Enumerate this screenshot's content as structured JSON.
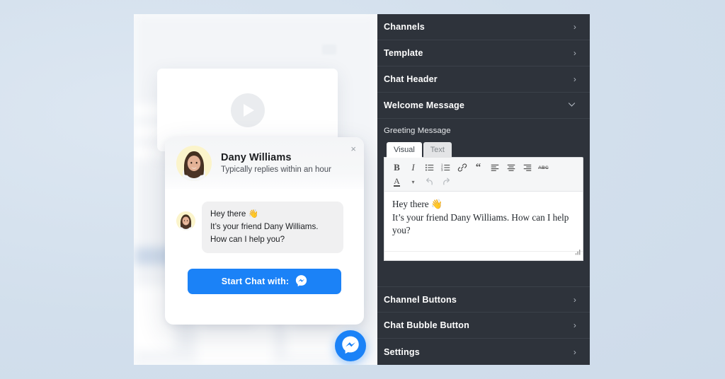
{
  "preview": {
    "widget": {
      "agent_name": "Dany Williams",
      "reply_time": "Typically replies within an hour",
      "close_label": "×",
      "avatar_name": "agent-avatar",
      "message_line1": "Hey there 👋",
      "message_line2": "It’s your friend Dany Williams. How can I help you?",
      "cta_label": "Start Chat with:",
      "cta_icon": "messenger-icon",
      "cta_color": "#1b82f7"
    },
    "floating_button": {
      "icon": "messenger-icon",
      "color": "#1b82f7"
    },
    "video_placeholder_icon": "play-icon"
  },
  "sidebar": {
    "background": "#2e333b",
    "items": [
      {
        "label": "Channels",
        "icon": "chevron-right-icon",
        "expanded": false
      },
      {
        "label": "Template",
        "icon": "chevron-right-icon",
        "expanded": false
      },
      {
        "label": "Chat Header",
        "icon": "chevron-right-icon",
        "expanded": false
      },
      {
        "label": "Welcome Message",
        "icon": "chevron-down-icon",
        "expanded": true
      }
    ],
    "footer_items": [
      {
        "label": "Channel Buttons",
        "icon": "chevron-right-icon",
        "expanded": false
      },
      {
        "label": "Chat Bubble Button",
        "icon": "chevron-right-icon",
        "expanded": false
      },
      {
        "label": "Settings",
        "icon": "chevron-right-icon",
        "expanded": false
      }
    ],
    "panel": {
      "field_label": "Greeting Message",
      "tabs": [
        {
          "label": "Visual",
          "active": true
        },
        {
          "label": "Text",
          "active": false
        }
      ],
      "toolbar_row1": [
        {
          "name": "bold-icon",
          "glyph": "B"
        },
        {
          "name": "italic-icon",
          "glyph": "I"
        },
        {
          "name": "bullet-list-icon",
          "glyph": ""
        },
        {
          "name": "numbered-list-icon",
          "glyph": ""
        },
        {
          "name": "link-icon",
          "glyph": ""
        },
        {
          "name": "blockquote-icon",
          "glyph": "“"
        },
        {
          "name": "align-left-icon",
          "glyph": ""
        },
        {
          "name": "align-center-icon",
          "glyph": ""
        },
        {
          "name": "align-right-icon",
          "glyph": ""
        },
        {
          "name": "strikethrough-icon",
          "glyph": "ABC"
        }
      ],
      "toolbar_row2": [
        {
          "name": "text-color-icon",
          "glyph": "A"
        },
        {
          "name": "color-dropdown-icon",
          "glyph": "▾"
        },
        {
          "name": "undo-icon",
          "glyph": ""
        },
        {
          "name": "redo-icon",
          "glyph": ""
        }
      ],
      "content_line1": "Hey there 👋",
      "content_line2": "It’s your friend Dany Williams. How can I help you?",
      "resize_handle": "resize-grip-icon"
    }
  }
}
